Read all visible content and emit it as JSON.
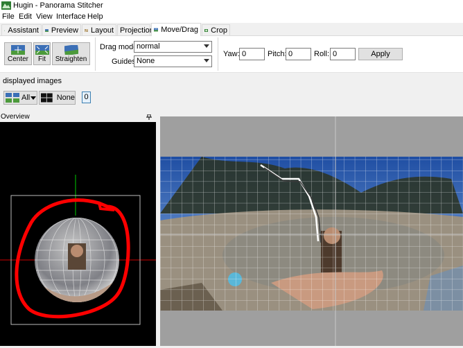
{
  "window": {
    "title": "Hugin - Panorama Stitcher"
  },
  "menu": [
    "File",
    "Edit",
    "View",
    "Interface",
    "Help"
  ],
  "tabs": [
    "Assistant",
    "Preview",
    "Layout",
    "Projection",
    "Move/Drag",
    "Crop"
  ],
  "active_tab": "Move/Drag",
  "toolbar": {
    "center_label": "Center",
    "fit_label": "Fit",
    "straighten_label": "Straighten",
    "drag_mode_label": "Drag mode:",
    "drag_mode_value": "normal",
    "guides_label": "Guides:",
    "guides_value": "None",
    "yaw_label": "Yaw:",
    "yaw_value": "0",
    "pitch_label": "Pitch:",
    "pitch_value": "0",
    "roll_label": "Roll:",
    "roll_value": "0",
    "apply_label": "Apply"
  },
  "displayed_images": {
    "heading": "displayed images",
    "all_label": "All",
    "none_label": "None",
    "image_number": "0"
  },
  "overview": {
    "title": "Overview"
  },
  "colors": {
    "annotation": "#ff0000",
    "axis_green": "#00cc00",
    "axis_red": "#cc0000",
    "selection": "#3c7fb1"
  }
}
